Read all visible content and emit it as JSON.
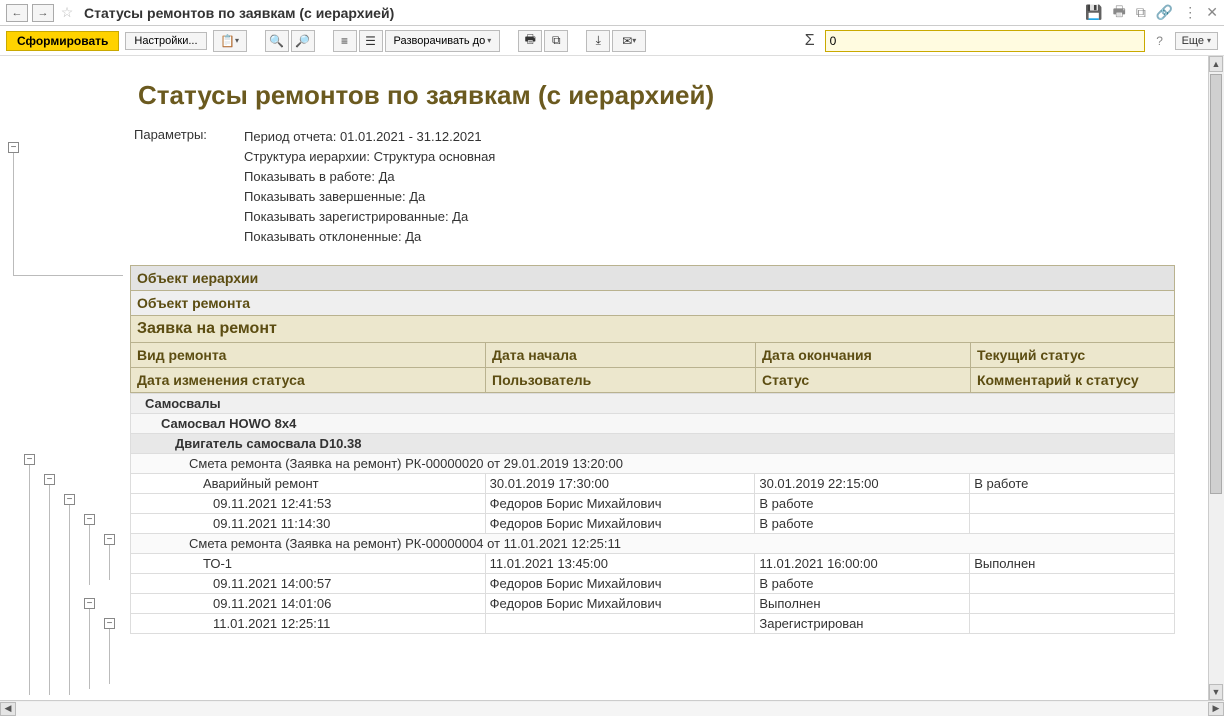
{
  "window": {
    "title": "Статусы ремонтов по заявкам (с иерархией)"
  },
  "toolbar": {
    "form": "Сформировать",
    "settings": "Настройки...",
    "expand": "Разворачивать до",
    "more": "Еще",
    "sum_value": "0"
  },
  "report": {
    "title": "Статусы ремонтов по заявкам (с иерархией)",
    "params_label": "Параметры:",
    "params": [
      "Период отчета: 01.01.2021 - 31.12.2021",
      "Структура иерархии: Структура основная",
      "Показывать в работе: Да",
      "Показывать завершенные: Да",
      "Показывать зарегистрированные: Да",
      "Показывать отклоненные: Да"
    ],
    "headers": {
      "h1": "Объект иерархии",
      "h2": "Объект ремонта",
      "h3": "Заявка на ремонт",
      "r4c1": "Вид ремонта",
      "r4c2": "Дата начала",
      "r4c3": "Дата окончания",
      "r4c4": "Текущий статус",
      "r5c1": "Дата изменения статуса",
      "r5c2": "Пользователь",
      "r5c3": "Статус",
      "r5c4": "Комментарий к статусу"
    },
    "rows": [
      {
        "level": 0,
        "c1": "Самосвалы",
        "c2": "",
        "c3": "",
        "c4": ""
      },
      {
        "level": 1,
        "c1": "Самосвал HOWO 8x4",
        "c2": "",
        "c3": "",
        "c4": ""
      },
      {
        "level": 2,
        "c1": "Двигатель самосвала D10.38",
        "c2": "",
        "c3": "",
        "c4": ""
      },
      {
        "level": 3,
        "c1": "Смета ремонта (Заявка на ремонт) РК-00000020 от 29.01.2019 13:20:00",
        "c2": "",
        "c3": "",
        "c4": ""
      },
      {
        "level": 4,
        "c1": "Аварийный ремонт",
        "c2": "30.01.2019 17:30:00",
        "c3": "30.01.2019 22:15:00",
        "c4": "В работе"
      },
      {
        "level": 5,
        "c1": "09.11.2021 12:41:53",
        "c2": "Федоров Борис Михайлович",
        "c3": "В работе",
        "c4": ""
      },
      {
        "level": 5,
        "c1": "09.11.2021 11:14:30",
        "c2": "Федоров Борис Михайлович",
        "c3": "В работе",
        "c4": ""
      },
      {
        "level": 3,
        "c1": "Смета ремонта (Заявка на ремонт) РК-00000004 от 11.01.2021 12:25:11",
        "c2": "",
        "c3": "",
        "c4": ""
      },
      {
        "level": 4,
        "c1": "ТО-1",
        "c2": "11.01.2021 13:45:00",
        "c3": "11.01.2021 16:00:00",
        "c4": "Выполнен"
      },
      {
        "level": 5,
        "c1": "09.11.2021 14:00:57",
        "c2": "Федоров Борис Михайлович",
        "c3": "В работе",
        "c4": ""
      },
      {
        "level": 5,
        "c1": "09.11.2021 14:01:06",
        "c2": "Федоров Борис Михайлович",
        "c3": "Выполнен",
        "c4": ""
      },
      {
        "level": 5,
        "c1": "11.01.2021 12:25:11",
        "c2": "",
        "c3": "Зарегистрирован",
        "c4": ""
      }
    ]
  }
}
